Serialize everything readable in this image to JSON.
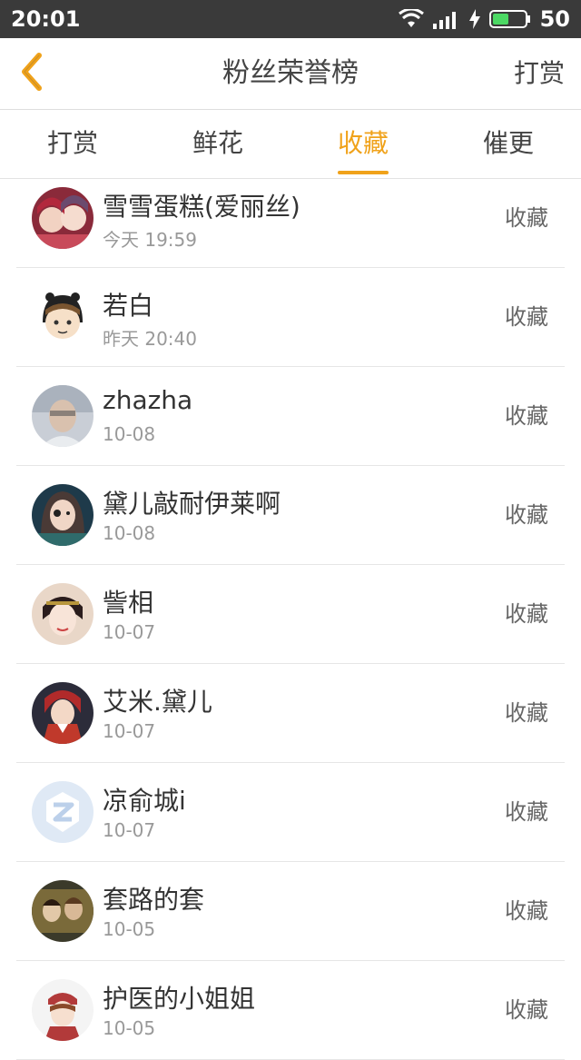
{
  "status_bar": {
    "time": "20:01",
    "battery": "50"
  },
  "header": {
    "title": "粉丝荣誉榜",
    "action": "打赏"
  },
  "tabs": [
    {
      "label": "打赏"
    },
    {
      "label": "鲜花"
    },
    {
      "label": "收藏"
    },
    {
      "label": "催更"
    }
  ],
  "active_tab": "收藏",
  "accent_color": "#f0a21a",
  "list": [
    {
      "name": "雪雪蛋糕(爱丽丝)",
      "time": "今天 19:59",
      "action": "收藏"
    },
    {
      "name": "若白",
      "time": "昨天 20:40",
      "action": "收藏"
    },
    {
      "name": "zhazha",
      "time": "10-08",
      "action": "收藏"
    },
    {
      "name": "黛儿敲耐伊莱啊",
      "time": "10-08",
      "action": "收藏"
    },
    {
      "name": "訾相",
      "time": "10-07",
      "action": "收藏"
    },
    {
      "name": "艾米.黛儿",
      "time": "10-07",
      "action": "收藏"
    },
    {
      "name": "凉俞城i",
      "time": "10-07",
      "action": "收藏"
    },
    {
      "name": "套路的套",
      "time": "10-05",
      "action": "收藏"
    },
    {
      "name": "护医的小姐姐",
      "time": "10-05",
      "action": "收藏"
    }
  ]
}
